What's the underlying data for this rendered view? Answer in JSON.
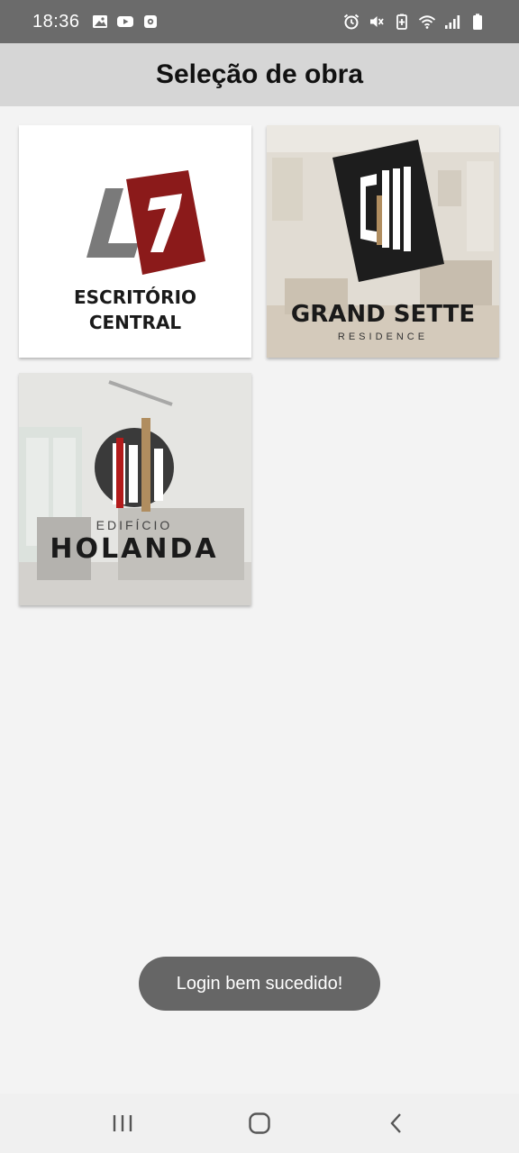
{
  "status_bar": {
    "time": "18:36",
    "left_icons": [
      "gallery-icon",
      "youtube-icon",
      "app-notification-icon"
    ],
    "right_icons": [
      "alarm-icon",
      "mute-icon",
      "battery-saver-icon",
      "wifi-icon",
      "signal-icon",
      "battery-icon"
    ]
  },
  "app_bar": {
    "title": "Seleção de obra"
  },
  "projects": [
    {
      "logo_line1": "ESCRITÓRIO",
      "logo_line2": "CENTRAL",
      "logo_mark": "7",
      "accent": "#8b1a1a"
    },
    {
      "logo_line1": "GRAND SETTE",
      "logo_line2": "RESIDENCE",
      "accent": "#b08d5f"
    },
    {
      "logo_line1": "EDIFÍCIO",
      "logo_line2": "HOLANDA",
      "accent": "#b31b1b"
    }
  ],
  "toast": {
    "message": "Login bem sucedido!"
  },
  "nav": {
    "icons": [
      "recent-apps-icon",
      "home-icon",
      "back-icon"
    ]
  }
}
